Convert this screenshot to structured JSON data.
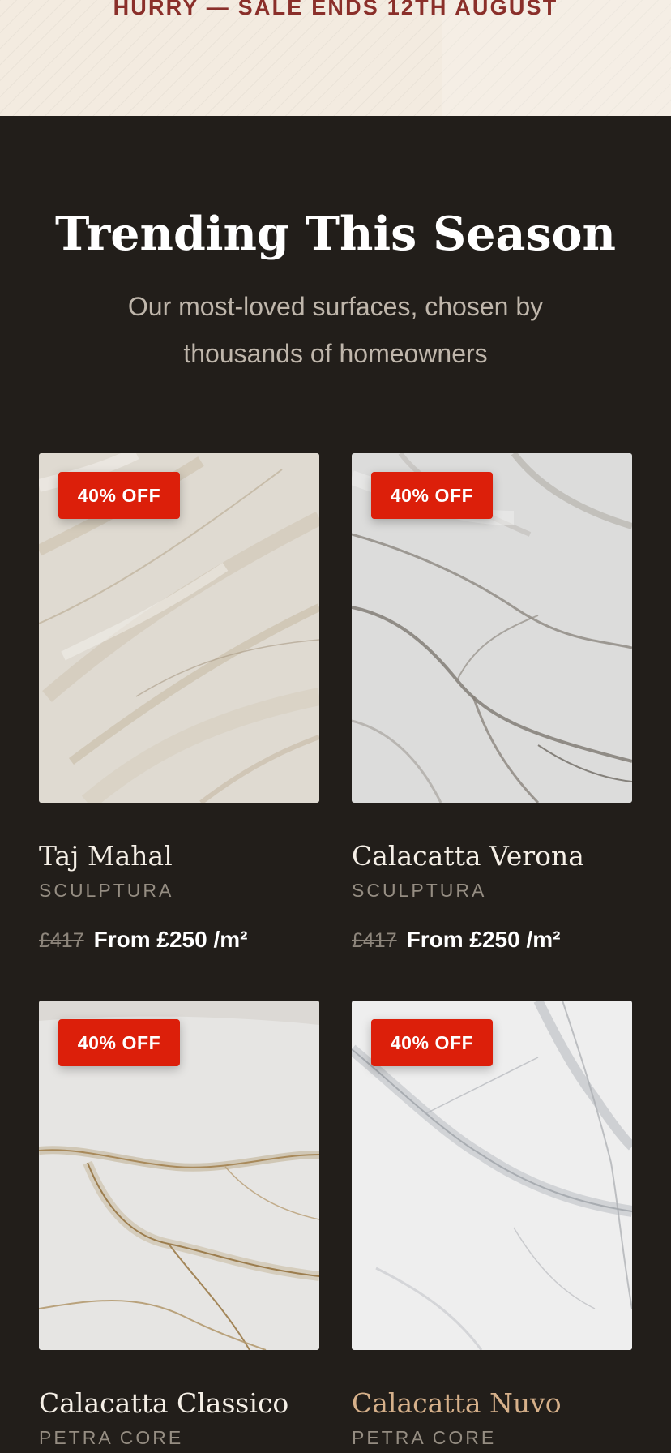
{
  "promo": {
    "text": "HURRY — SALE ENDS 12TH AUGUST"
  },
  "section": {
    "title": "Trending This Season",
    "subtitle": "Our most-loved surfaces, chosen by thousands of homeowners"
  },
  "products": [
    {
      "badge": "40% OFF",
      "name": "Taj Mahal",
      "collection": "SCULPTURA",
      "old_price": "£417",
      "price": "From £250 /m²",
      "texture": "taj-mahal-quartzite"
    },
    {
      "badge": "40% OFF",
      "name": "Calacatta Verona",
      "collection": "SCULPTURA",
      "old_price": "£417",
      "price": "From £250 /m²",
      "texture": "grey-veined-marble"
    },
    {
      "badge": "40% OFF",
      "name": "Calacatta Classico",
      "collection": "PETRA CORE",
      "texture": "gold-veined-marble"
    },
    {
      "badge": "40% OFF",
      "name": "Calacatta Nuvo",
      "collection": "PETRA CORE",
      "texture": "soft-grey-veined-marble"
    }
  ],
  "colors": {
    "background": "#221e1a",
    "badge": "#dc1f0a",
    "banner_text": "#8a2f2a",
    "highlight_name": "#d6b08a"
  }
}
